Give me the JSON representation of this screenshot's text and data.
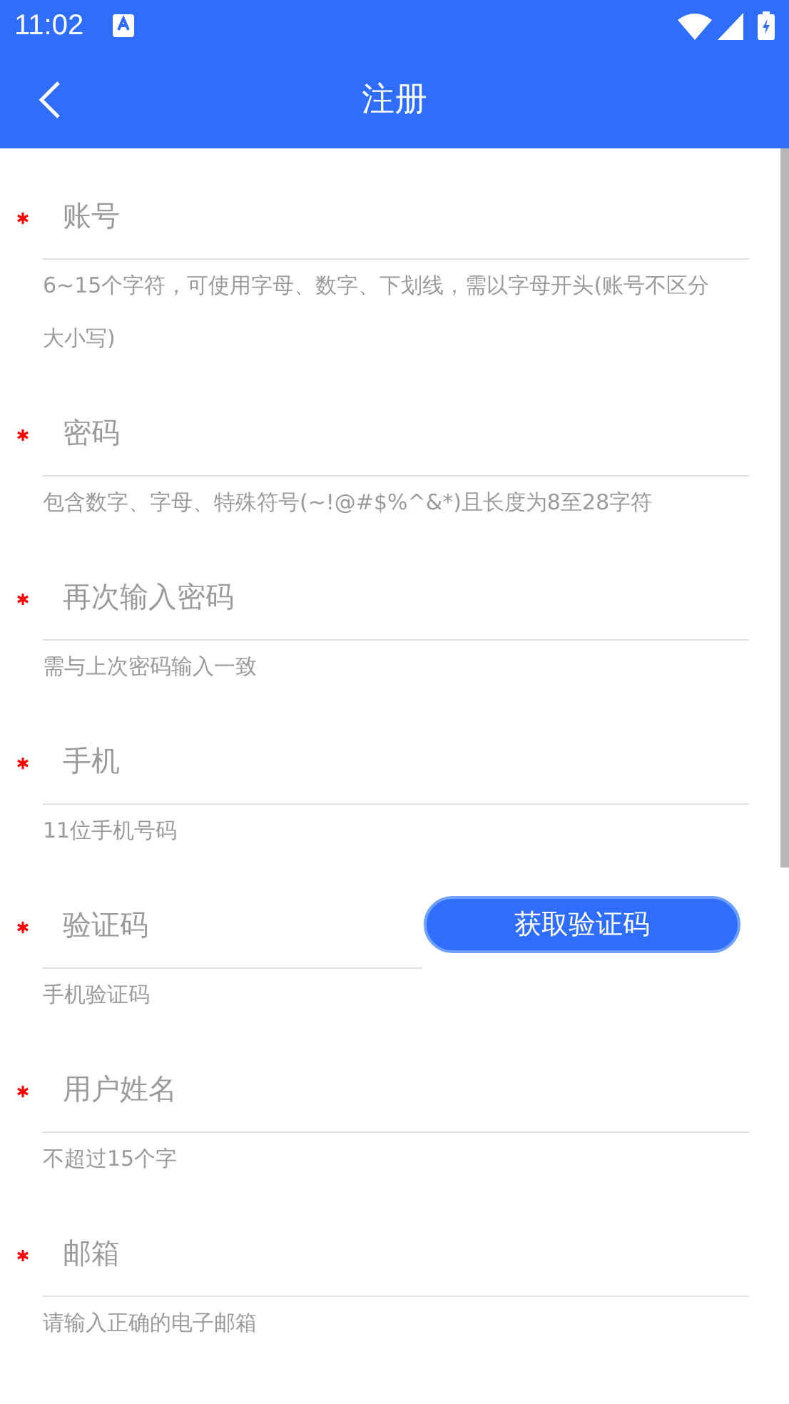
{
  "status_bar": {
    "time": "11:02"
  },
  "nav": {
    "title": "注册"
  },
  "fields": [
    {
      "kind": "text",
      "label": "账号",
      "required": true,
      "hint": "6~15个字符，可使用字母、数字、下划线，需以字母开头(账号不区分大小写)"
    },
    {
      "kind": "text",
      "label": "密码",
      "required": true,
      "hint": "包含数字、字母、特殊符号(~!@#$%^&*)且长度为8至28字符"
    },
    {
      "kind": "text",
      "label": "再次输入密码",
      "required": true,
      "hint": "需与上次密码输入一致"
    },
    {
      "kind": "text",
      "label": "手机",
      "required": true,
      "hint": "11位手机号码"
    },
    {
      "kind": "code",
      "label": "验证码",
      "required": true,
      "hint": "手机验证码",
      "button": "获取验证码"
    },
    {
      "kind": "text",
      "label": "用户姓名",
      "required": true,
      "hint": "不超过15个字"
    },
    {
      "kind": "text",
      "label": "邮箱",
      "required": true,
      "hint": "请输入正确的电子邮箱"
    }
  ]
}
